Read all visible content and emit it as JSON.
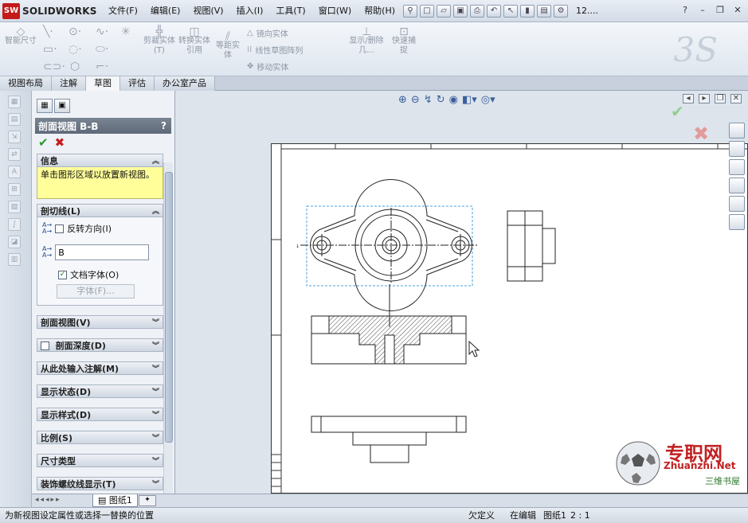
{
  "app": {
    "brand": "SOLIDWORKS",
    "badge": "SW"
  },
  "menu": [
    "文件(F)",
    "编辑(E)",
    "视图(V)",
    "插入(I)",
    "工具(T)",
    "窗口(W)",
    "帮助(H)"
  ],
  "toolbar": {
    "doc_name": "12...."
  },
  "cmd": {
    "smart_dim": "智能尺寸",
    "trim": "剪裁实体(T)",
    "convert": "转换实体引用",
    "offset": "等距实体",
    "mirror": "镜向实体",
    "linear_pattern": "线性草图阵列",
    "move": "移动实体",
    "show_delete": "显示/删除几...",
    "quick_snap": "快速捕捉"
  },
  "tabs": [
    "视图布局",
    "注解",
    "草图",
    "评估",
    "办公室产品"
  ],
  "active_tab": "草图",
  "pm": {
    "title": "剖面视图 B-B",
    "help": "?",
    "info_header": "信息",
    "info_text": "单击图形区域以放置新视图。",
    "cutline_header": "剖切线(L)",
    "reverse_label": "反转方向(I)",
    "label_value": "B",
    "doc_font_label": "文档字体(O)",
    "font_button": "字体(F)...",
    "sections": [
      "剖面视图(V)",
      "剖面深度(D)",
      "从此处输入注解(M)",
      "显示状态(D)",
      "显示样式(D)",
      "比例(S)",
      "尺寸类型",
      "装饰螺纹线显示(T)"
    ]
  },
  "sheet_tab": "图纸1",
  "status": {
    "message": "为新视图设定属性或选择一替换的位置",
    "defined": "欠定义",
    "editing": "在编辑",
    "sheet": "图纸1",
    "scale": "2 : 1"
  },
  "watermark": {
    "text": "专职网",
    "url": "Zhuanzhi.Net",
    "sub": "三维书屋"
  }
}
